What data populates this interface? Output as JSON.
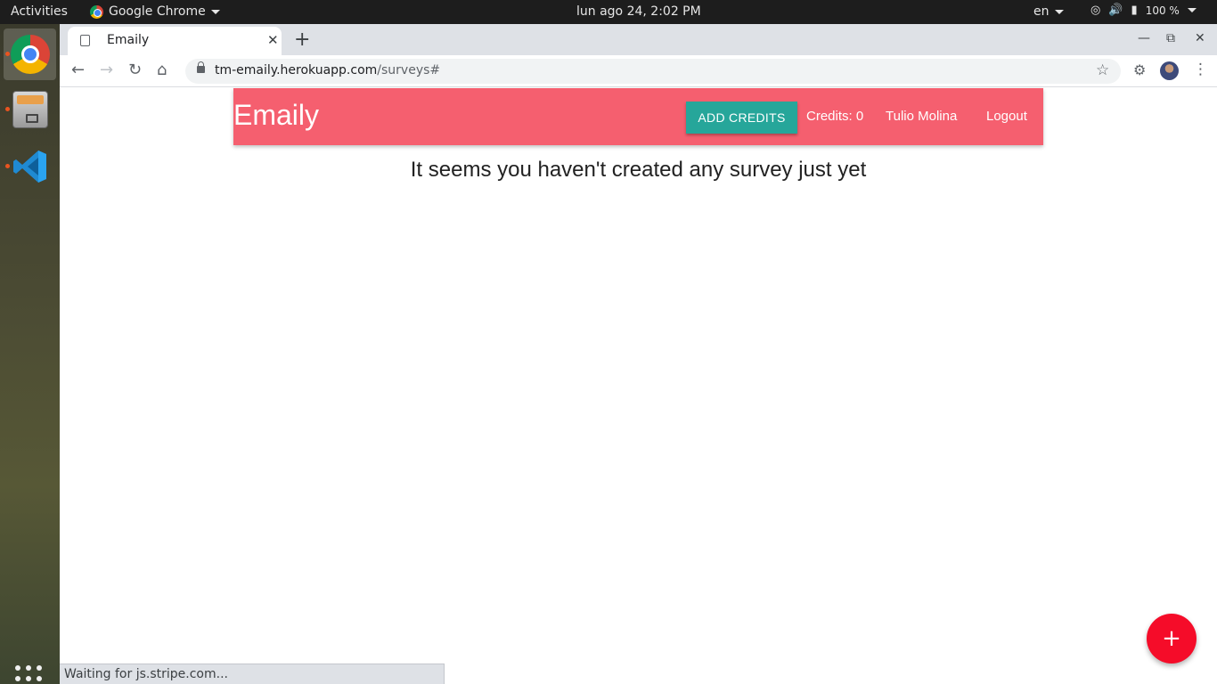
{
  "system": {
    "activities": "Activities",
    "app_name": "Google Chrome",
    "clock": "lun ago 24,  2:02 PM",
    "language": "en",
    "battery": "100 %"
  },
  "browser": {
    "tab_title": "Emaily",
    "url_host": "tm-emaily.herokuapp.com",
    "url_path": "/surveys#",
    "status_text": "Waiting for js.stripe.com..."
  },
  "app": {
    "brand": "Emaily",
    "add_credits_label": "ADD CREDITS",
    "credits_label": "Credits: 0",
    "user_name": "Tulio Molina",
    "logout_label": "Logout",
    "empty_message": "It seems you haven't created any survey just yet",
    "fab_label": "+"
  },
  "colors": {
    "navbar": "#f55f6f",
    "add_credits": "#26a69a",
    "fab": "#f50c29"
  }
}
